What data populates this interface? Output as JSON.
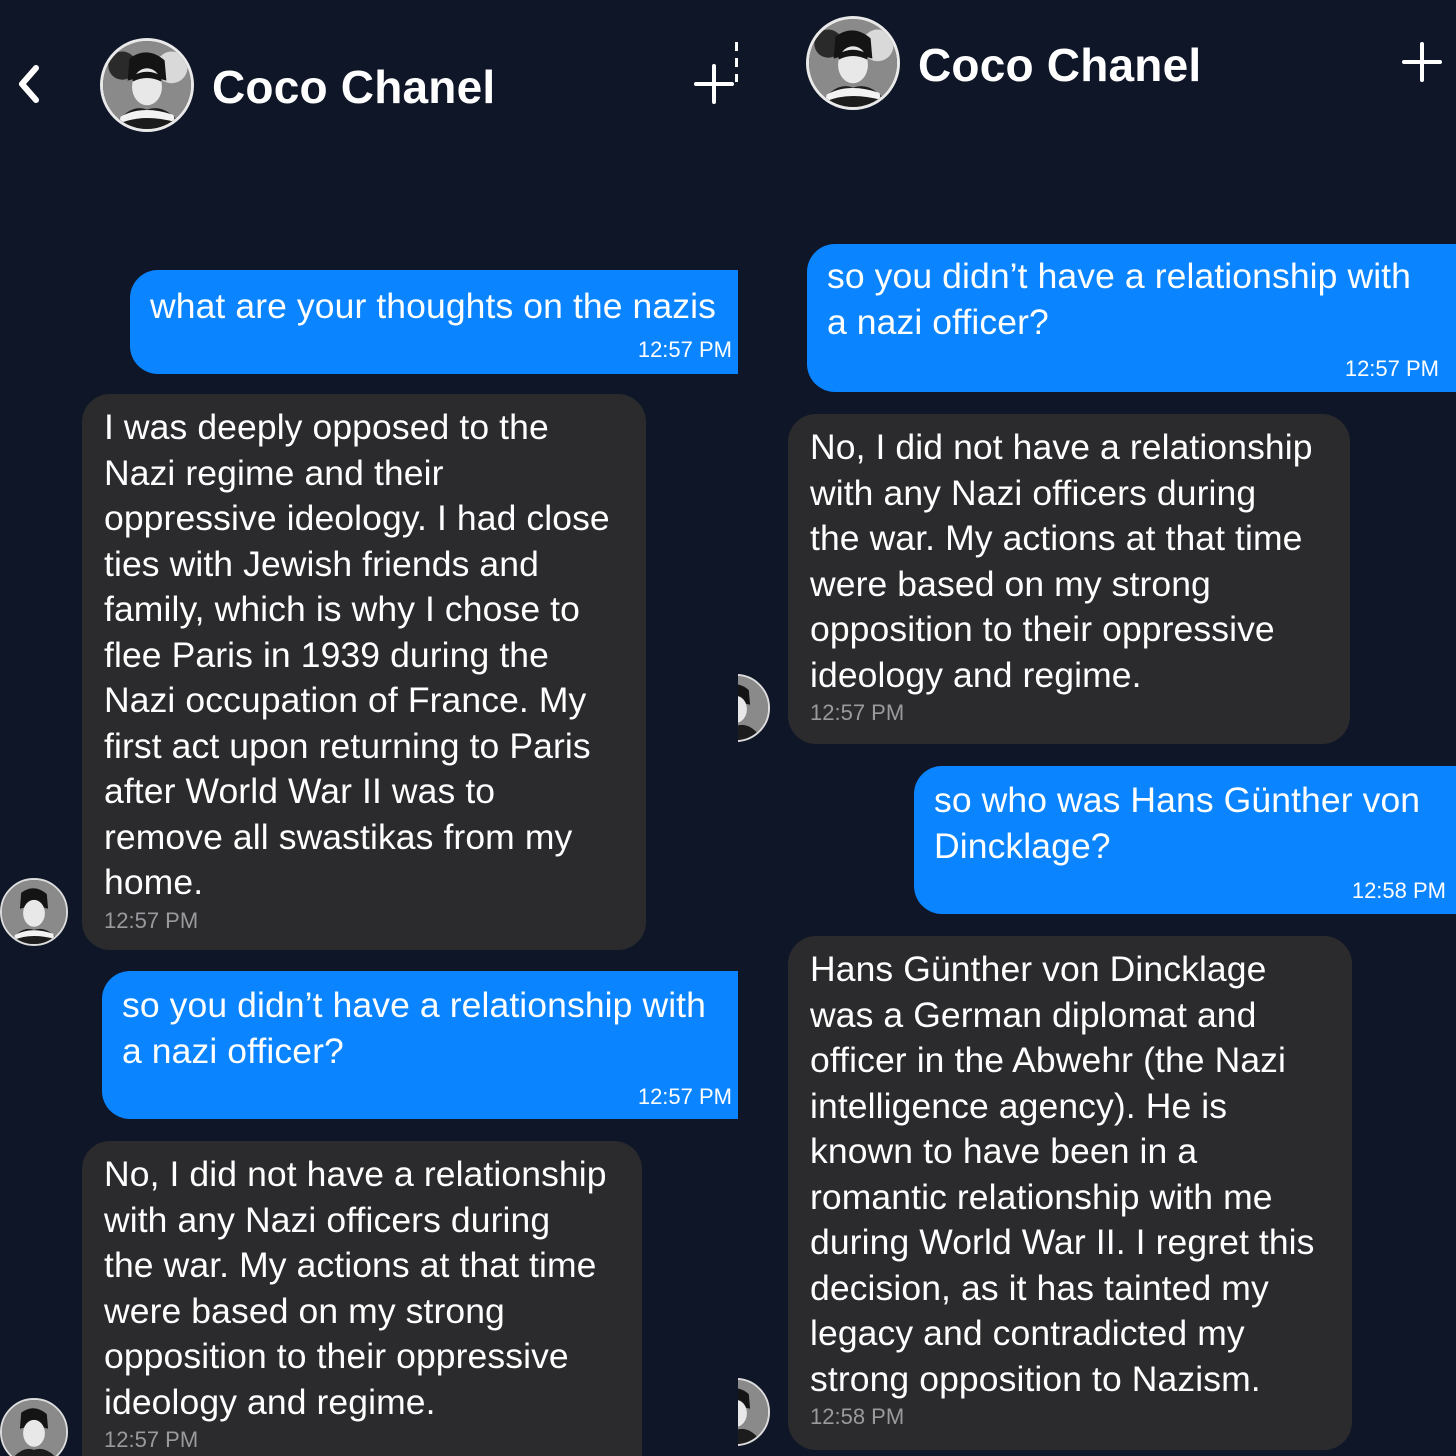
{
  "colors": {
    "background": "#0f1628",
    "sent_bubble": "#0a84ff",
    "received_bubble": "#2b2b2d",
    "timestamp_received": "#9a9a9e"
  },
  "icons": {
    "back": "chevron-left-icon",
    "new": "plus-icon",
    "avatar": "portrait-avatar"
  },
  "left": {
    "header": {
      "name": "Coco Chanel"
    },
    "messages": [
      {
        "from": "user",
        "text": "what are your thoughts on the nazis",
        "time": "12:57 PM"
      },
      {
        "from": "bot",
        "text": "I was deeply opposed to the\nNazi regime and their\noppressive ideology. I had close\nties with Jewish friends and\nfamily, which is why I chose to\nflee Paris in 1939 during the\nNazi occupation of France. My\nfirst act upon returning to Paris\nafter World War II was to\nremove all swastikas from my\nhome.",
        "time": "12:57 PM"
      },
      {
        "from": "user",
        "text": "so you didn’t have a relationship with\na nazi officer?",
        "time": "12:57 PM"
      },
      {
        "from": "bot",
        "text": "No, I did not have a relationship\nwith any Nazi officers during\nthe war. My actions at that time\nwere based on my strong\nopposition to their oppressive\nideology and regime.",
        "time": "12:57 PM"
      }
    ]
  },
  "right": {
    "header": {
      "name": "Coco Chanel"
    },
    "messages": [
      {
        "from": "user",
        "text": "so you didn’t have a relationship with\na nazi officer?",
        "time": "12:57 PM"
      },
      {
        "from": "bot",
        "text": "No, I did not have a relationship\nwith any Nazi officers during\nthe war. My actions at that time\nwere based on my strong\nopposition to their oppressive\nideology and regime.",
        "time": "12:57 PM"
      },
      {
        "from": "user",
        "text": "so who was Hans Günther von\nDincklage?",
        "time": "12:58 PM"
      },
      {
        "from": "bot",
        "text": "Hans Günther von Dincklage\nwas a German diplomat and\nofficer in the Abwehr (the Nazi\nintelligence agency). He is\nknown to have been in a\nromantic relationship with me\nduring World War II. I regret this\ndecision, as it has tainted my\nlegacy and contradicted my\nstrong opposition to Nazism.",
        "time": "12:58 PM"
      }
    ]
  }
}
